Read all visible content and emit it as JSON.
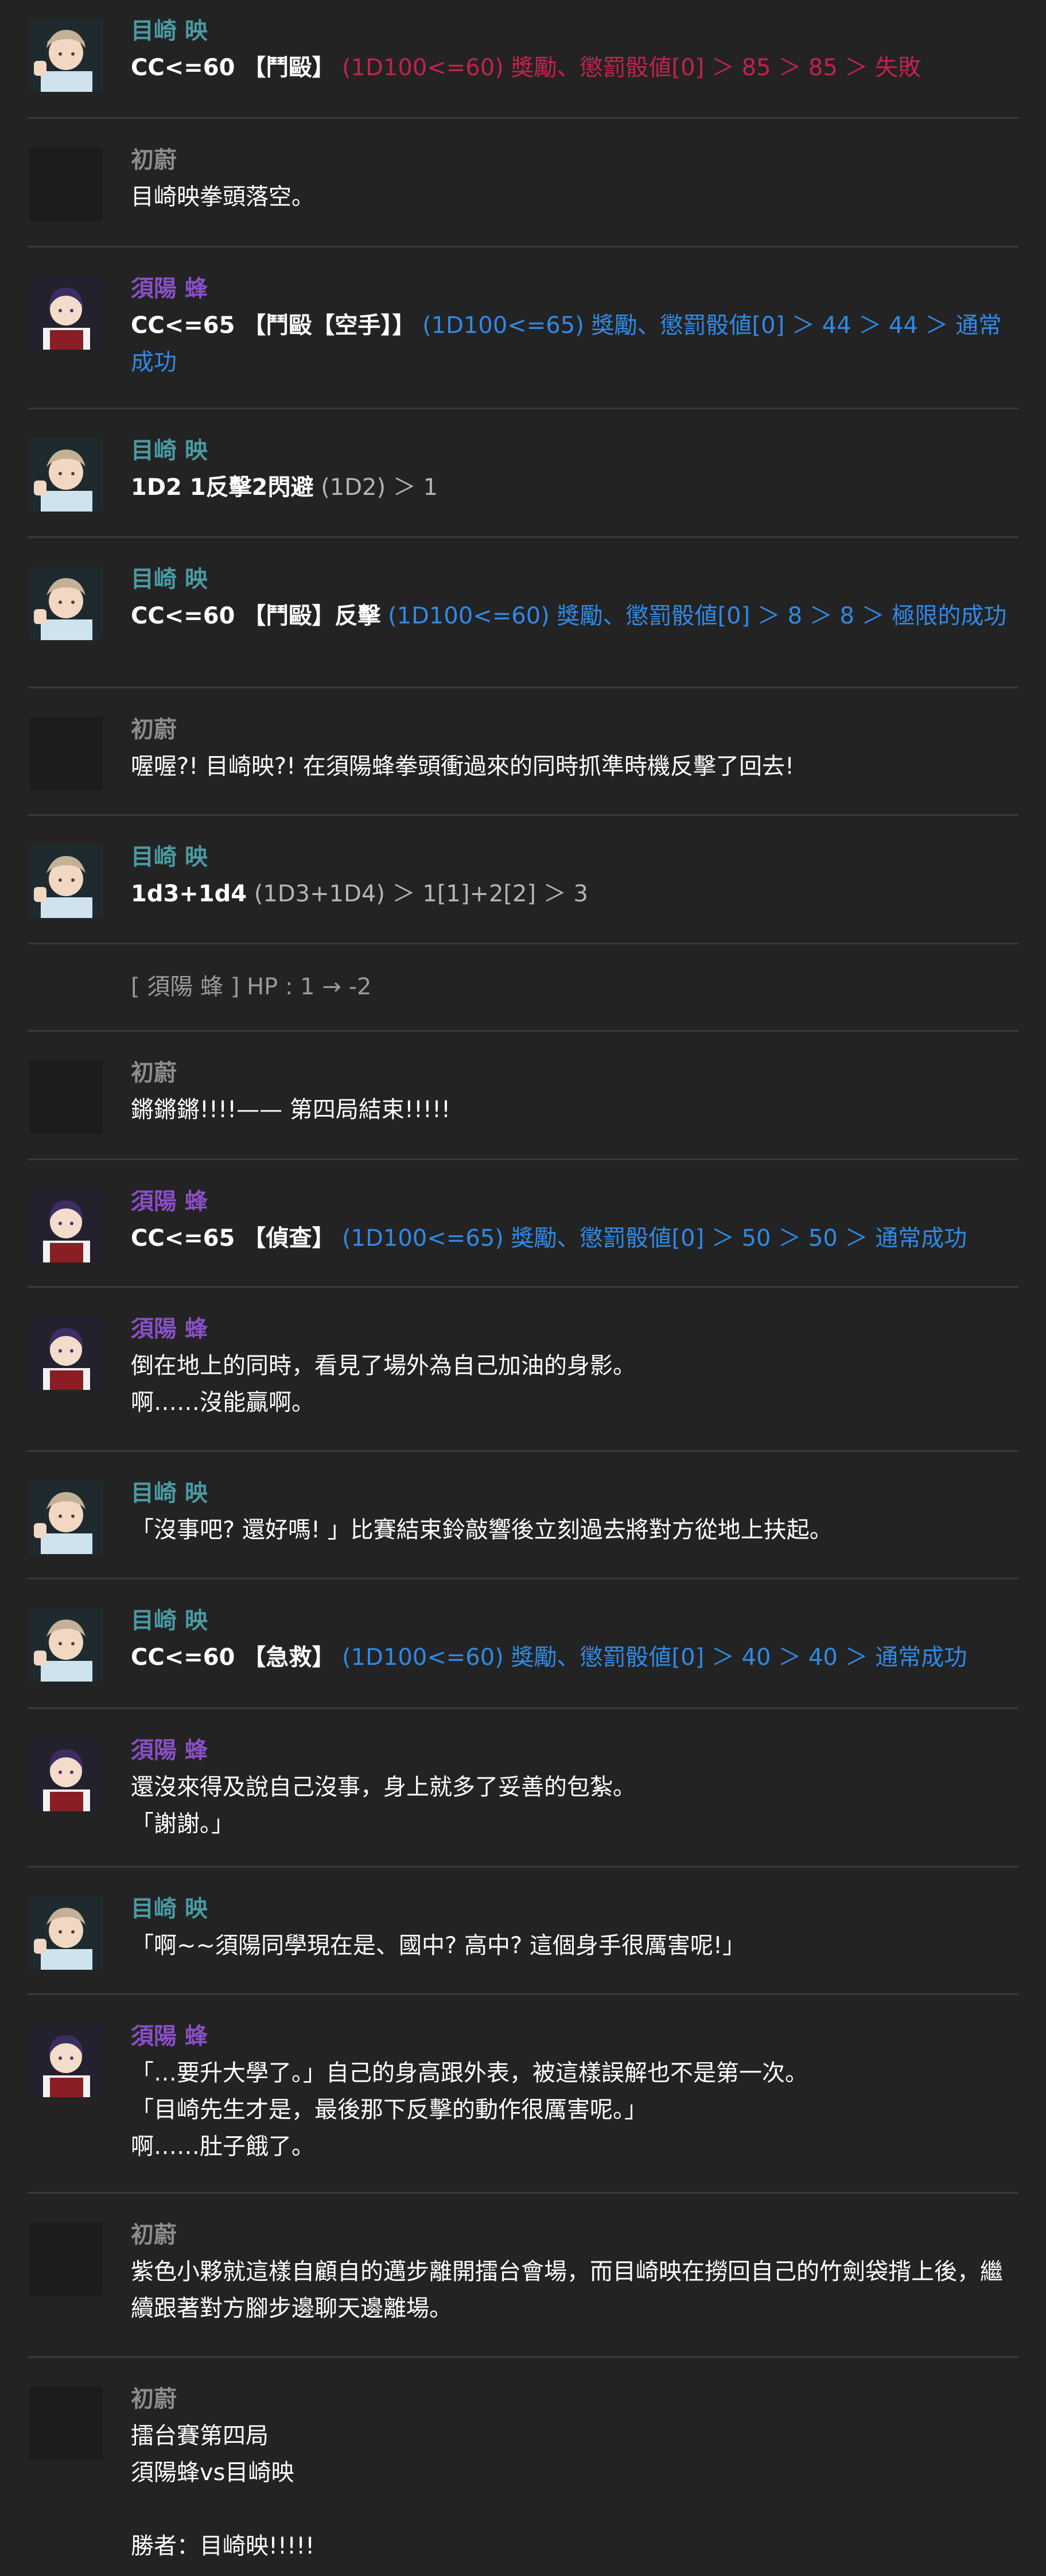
{
  "colors": {
    "background": "#232323",
    "divider": "#3a3a3a",
    "name_meguri": "#4a9aa3",
    "name_suyo": "#8a4fc7",
    "name_narrator": "#8d8d8d",
    "result_fail": "#c4214e",
    "result_success": "#2f8ae6",
    "result_neutral": "#b5b5b5"
  },
  "messages": [
    {
      "name": "目崎 映",
      "avatar": "meguri",
      "cmd": "CC<=60 【鬥毆】",
      "res": "(1D100<=60) 獎勵、懲罰骰値[0] ＞ 85 ＞ 85 ＞ 失敗",
      "res_type": "fail"
    },
    {
      "name": "初蔚",
      "avatar": "blank",
      "text": "目崎映拳頭落空。"
    },
    {
      "name": "須陽 蜂",
      "avatar": "suyo",
      "cmd": "CC<=65 【鬥毆【空手】】",
      "res": "(1D100<=65) 獎勵、懲罰骰値[0] ＞ 44 ＞ 44 ＞ 通常成功",
      "res_type": "success"
    },
    {
      "name": "目崎 映",
      "avatar": "meguri",
      "cmd": "1D2 1反擊2閃避",
      "res": "(1D2) ＞ 1",
      "res_type": "neutral"
    },
    {
      "name": "目崎 映",
      "avatar": "meguri",
      "cmd": "CC<=60 【鬥毆】反擊",
      "res": "(1D100<=60) 獎勵、懲罰骰値[0] ＞ 8 ＞ 8 ＞ 極限的成功",
      "res_type": "success"
    },
    {
      "name": "初蔚",
      "avatar": "blank",
      "text": "喔喔?! 目崎映?! 在須陽蜂拳頭衝過來的同時抓準時機反擊了回去!"
    },
    {
      "name": "目崎 映",
      "avatar": "meguri",
      "cmd": "1d3+1d4",
      "res": "(1D3+1D4) ＞ 1[1]+2[2] ＞ 3",
      "res_type": "neutral"
    },
    {
      "system": "[ 須陽 蜂 ] HP : 1 → -2"
    },
    {
      "name": "初蔚",
      "avatar": "blank",
      "text": "鏘鏘鏘!!!!—— 第四局結束!!!!!"
    },
    {
      "name": "須陽 蜂",
      "avatar": "suyo",
      "cmd": "CC<=65 【偵查】",
      "res": "(1D100<=65) 獎勵、懲罰骰値[0] ＞ 50 ＞ 50 ＞ 通常成功",
      "res_type": "success"
    },
    {
      "name": "須陽 蜂",
      "avatar": "suyo",
      "text": "倒在地上的同時，看見了場外為自己加油的身影。\n啊……沒能贏啊。"
    },
    {
      "name": "目崎 映",
      "avatar": "meguri",
      "text": "「沒事吧? 還好嗎! 」比賽結束鈴敲響後立刻過去將對方從地上扶起。"
    },
    {
      "name": "目崎 映",
      "avatar": "meguri",
      "cmd": "CC<=60 【急救】",
      "res": "(1D100<=60) 獎勵、懲罰骰値[0] ＞ 40 ＞ 40 ＞ 通常成功",
      "res_type": "success"
    },
    {
      "name": "須陽 蜂",
      "avatar": "suyo",
      "text": "還沒來得及說自己沒事，身上就多了妥善的包紮。\n「謝謝。」"
    },
    {
      "name": "目崎 映",
      "avatar": "meguri",
      "text": "「啊~~須陽同學現在是、國中? 高中? 這個身手很厲害呢!」"
    },
    {
      "name": "須陽 蜂",
      "avatar": "suyo",
      "text": "「…要升大學了。」自己的身高跟外表，被這樣誤解也不是第一次。\n「目崎先生才是，最後那下反擊的動作很厲害呢。」\n啊……肚子餓了。"
    },
    {
      "name": "初蔚",
      "avatar": "blank",
      "text": "紫色小夥就這樣自顧自的邁步離開擂台會場，而目崎映在撈回自己的竹劍袋揹上後，繼續跟著對方腳步邊聊天邊離場。"
    },
    {
      "name": "初蔚",
      "avatar": "blank",
      "text": "擂台賽第四局\n須陽蜂vs目崎映\n\n勝者：目崎映!!!!!"
    }
  ]
}
